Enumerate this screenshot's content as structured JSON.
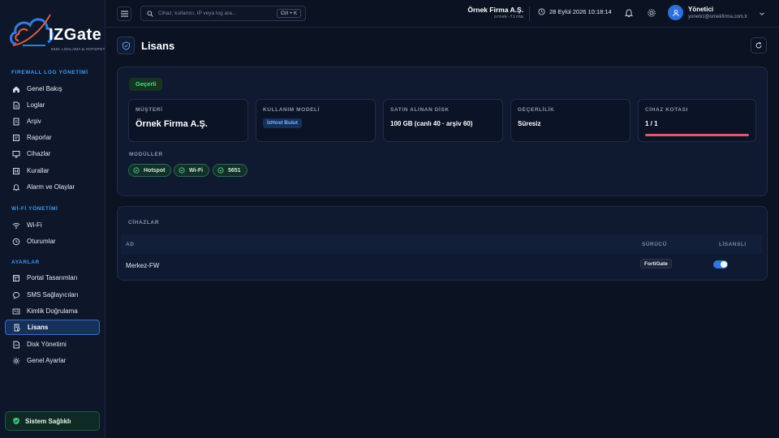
{
  "colors": {
    "accent": "#3b9af0",
    "success": "#4ade80",
    "danger": "#e05a5f",
    "background": "#0b1222",
    "panel": "#0f1a31"
  },
  "brand": {
    "name": "IZGate",
    "tagline": "5651 LOGLAMA & HOTSPOT"
  },
  "sidebar": {
    "sections": [
      {
        "title": "FIREWALL LOG YÖNETİMİ",
        "items": [
          {
            "label": "Genel Bakış",
            "icon": "home-icon"
          },
          {
            "label": "Loglar",
            "icon": "document-icon"
          },
          {
            "label": "Arşiv",
            "icon": "archive-icon"
          },
          {
            "label": "Raporlar",
            "icon": "report-icon"
          },
          {
            "label": "Cihazlar",
            "icon": "monitor-icon"
          },
          {
            "label": "Kurallar",
            "icon": "rules-icon"
          },
          {
            "label": "Alarm ve Olaylar",
            "icon": "bell-icon"
          }
        ]
      },
      {
        "title": "Wİ-Fİ YÖNETİMİ",
        "items": [
          {
            "label": "Wi-Fi",
            "icon": "wifi-icon"
          },
          {
            "label": "Oturumlar",
            "icon": "clock-icon"
          }
        ]
      },
      {
        "title": "AYARLAR",
        "items": [
          {
            "label": "Portal Tasarımları",
            "icon": "layout-icon"
          },
          {
            "label": "SMS Sağlayıcıları",
            "icon": "chat-icon"
          },
          {
            "label": "Kimlik Doğrulama",
            "icon": "id-card-icon"
          },
          {
            "label": "Lisans",
            "icon": "license-icon",
            "active": true
          },
          {
            "label": "Disk Yönetimi",
            "icon": "disk-icon"
          },
          {
            "label": "Genel Ayarlar",
            "icon": "gear-icon"
          }
        ]
      }
    ],
    "health_label": "Sistem Sağlıklı"
  },
  "topbar": {
    "search_placeholder": "Cihaz, kullanıcı, IP veya log ara...",
    "search_shortcut": "Ctrl + K",
    "company_name": "Örnek Firma A.Ş.",
    "company_slug": "ornek-firma",
    "datetime": "28 Eylül 2026 10:18:14",
    "user_name": "Yönetici",
    "user_email": "yonetici@ornekfirma.com.tr"
  },
  "page": {
    "title": "Lisans"
  },
  "license": {
    "status": "Geçerli",
    "cards": {
      "customer_label": "MÜŞTERİ",
      "customer_value": "Örnek Firma A.Ş.",
      "model_label": "KULLANIM MODELİ",
      "model_value": "İzHost Bulut",
      "disk_label": "SATIN ALINAN DİSK",
      "disk_value": "100 GB (canlı 40 · arşiv 60)",
      "validity_label": "GEÇERLİLİK",
      "validity_value": "Süresiz",
      "quota_label": "CİHAZ KOTASI",
      "quota_value": "1 / 1",
      "quota_fraction": 1.0
    },
    "modules_label": "MODÜLLER",
    "modules": [
      "Hotspot",
      "Wi-Fi",
      "5651"
    ]
  },
  "devices": {
    "title": "CİHAZLAR",
    "columns": {
      "name": "AD",
      "driver": "SÜRÜCÜ",
      "licensed": "LİSANSLI"
    },
    "rows": [
      {
        "name": "Merkez-FW",
        "driver": "FortiGate",
        "licensed": true
      }
    ]
  }
}
